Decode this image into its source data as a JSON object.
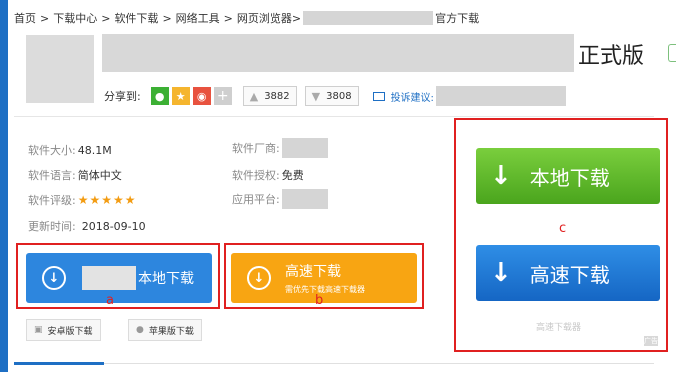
{
  "breadcrumb": {
    "items": [
      "首页",
      "下载中心",
      "软件下载",
      "网络工具",
      "网页浏览器>"
    ],
    "separator": ">",
    "suffix": "官方下载"
  },
  "header": {
    "title_suffix": "正式版",
    "share_label": "分享到:",
    "share_icons": [
      "wechat-icon",
      "star-icon",
      "weibo-icon",
      "plus-icon"
    ],
    "likes": "3882",
    "dislikes": "3808",
    "suggest_label": "投诉建议:"
  },
  "info": {
    "size_label": "软件大小:",
    "size_value": "48.1M",
    "lang_label": "软件语言:",
    "lang_value": "简体中文",
    "rating_label": "软件评级:",
    "rating_value": "★★★★★",
    "update_label": "更新时间:",
    "update_value": "2018-09-10",
    "vendor_label": "软件厂商:",
    "license_label": "软件授权:",
    "license_value": "免费",
    "platform_label": "应用平台:"
  },
  "buttons": {
    "local_label": "本地下载",
    "fast_label": "高速下载",
    "fast_sub": "需优先下载高速下载器",
    "android_label": "安卓版下载",
    "apple_label": "苹果版下载",
    "big_local_label": "本地下载",
    "big_fast_label": "高速下载",
    "gray_label": "高速下载器",
    "ad_tag": "广告"
  },
  "annotations": {
    "a": "a",
    "b": "b",
    "c": "c"
  },
  "colors": {
    "brand_blue": "#1e6fc4",
    "button_blue": "#2d86de",
    "button_orange": "#f8a512",
    "button_green": "#4aa51d",
    "annotation_red": "#e02020"
  }
}
